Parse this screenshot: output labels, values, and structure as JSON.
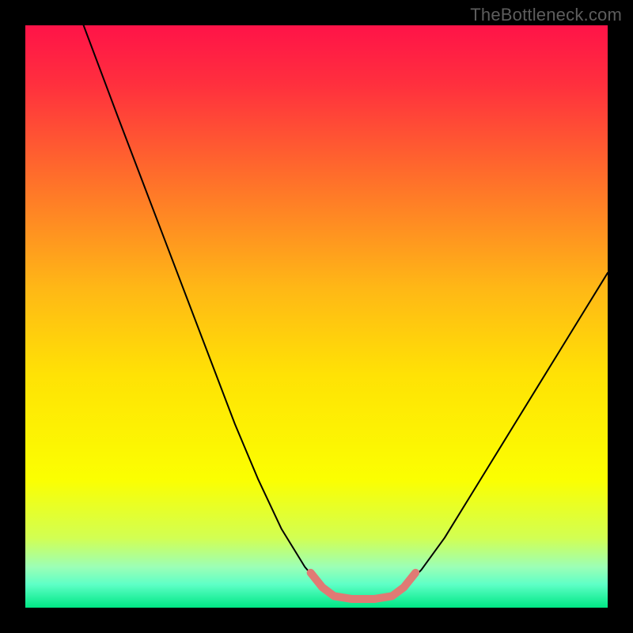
{
  "watermark": {
    "text": "TheBottleneck.com"
  },
  "chart_data": {
    "type": "line",
    "title": "",
    "xlabel": "",
    "ylabel": "",
    "xlim": [
      0,
      100
    ],
    "ylim": [
      0,
      100
    ],
    "background_gradient_stops": [
      {
        "offset": 0.0,
        "color": "#ff1348"
      },
      {
        "offset": 0.1,
        "color": "#ff2f3e"
      },
      {
        "offset": 0.25,
        "color": "#ff6a2c"
      },
      {
        "offset": 0.45,
        "color": "#ffb716"
      },
      {
        "offset": 0.6,
        "color": "#ffe205"
      },
      {
        "offset": 0.78,
        "color": "#fbff01"
      },
      {
        "offset": 0.88,
        "color": "#d2ff52"
      },
      {
        "offset": 0.93,
        "color": "#9cffb6"
      },
      {
        "offset": 0.96,
        "color": "#5effc6"
      },
      {
        "offset": 1.0,
        "color": "#00e785"
      }
    ],
    "series": [
      {
        "name": "bottleneck-curve",
        "stroke": "#000000",
        "stroke_width": 2,
        "points": [
          {
            "x": 10.0,
            "y": 100.0
          },
          {
            "x": 13.0,
            "y": 92.0
          },
          {
            "x": 16.0,
            "y": 84.0
          },
          {
            "x": 20.0,
            "y": 73.5
          },
          {
            "x": 24.0,
            "y": 63.0
          },
          {
            "x": 28.0,
            "y": 52.5
          },
          {
            "x": 32.0,
            "y": 42.0
          },
          {
            "x": 36.0,
            "y": 31.5
          },
          {
            "x": 40.0,
            "y": 22.0
          },
          {
            "x": 44.0,
            "y": 13.5
          },
          {
            "x": 48.0,
            "y": 7.0
          },
          {
            "x": 51.0,
            "y": 3.5
          },
          {
            "x": 53.0,
            "y": 2.0
          },
          {
            "x": 56.0,
            "y": 1.5
          },
          {
            "x": 60.0,
            "y": 1.5
          },
          {
            "x": 63.0,
            "y": 2.0
          },
          {
            "x": 65.0,
            "y": 3.5
          },
          {
            "x": 68.0,
            "y": 6.5
          },
          {
            "x": 72.0,
            "y": 12.0
          },
          {
            "x": 76.0,
            "y": 18.5
          },
          {
            "x": 80.0,
            "y": 25.0
          },
          {
            "x": 84.0,
            "y": 31.5
          },
          {
            "x": 88.0,
            "y": 38.0
          },
          {
            "x": 92.0,
            "y": 44.5
          },
          {
            "x": 96.0,
            "y": 51.0
          },
          {
            "x": 100.0,
            "y": 57.5
          }
        ]
      },
      {
        "name": "bottom-highlight",
        "stroke": "#e07a74",
        "stroke_width": 10,
        "points": [
          {
            "x": 49.0,
            "y": 6.0
          },
          {
            "x": 51.0,
            "y": 3.5
          },
          {
            "x": 53.0,
            "y": 2.0
          },
          {
            "x": 56.0,
            "y": 1.5
          },
          {
            "x": 60.0,
            "y": 1.5
          },
          {
            "x": 63.0,
            "y": 2.0
          },
          {
            "x": 65.0,
            "y": 3.5
          },
          {
            "x": 67.0,
            "y": 6.0
          }
        ]
      }
    ]
  }
}
